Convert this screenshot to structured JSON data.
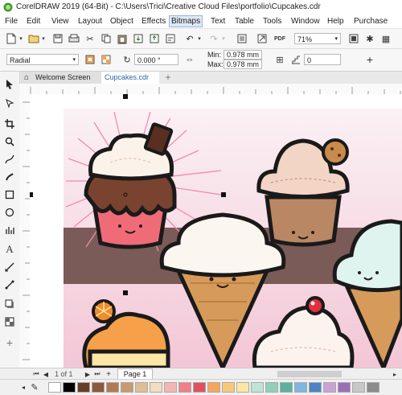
{
  "title": "CorelDRAW 2019 (64-Bit) - C:\\Users\\Trici\\Creative Cloud Files\\portfolio\\Cupcakes.cdr",
  "menu": [
    "File",
    "Edit",
    "View",
    "Layout",
    "Object",
    "Effects",
    "Bitmaps",
    "Text",
    "Table",
    "Tools",
    "Window",
    "Help",
    "Purchase"
  ],
  "menu_active": "Bitmaps",
  "toolbar": {
    "zoom": "71%"
  },
  "propbar": {
    "fill_type": "Radial",
    "angle": "0.000 °",
    "min_label": "Min:",
    "min_value": "0.978 mm",
    "max_label": "Max:",
    "max_value": "0.978 mm",
    "count": "0"
  },
  "tabs": {
    "welcome": "Welcome Screen",
    "doc": "Cupcakes.cdr",
    "add": "+"
  },
  "status": {
    "page_counter": "1 of 1",
    "page_tab": "Page 1"
  },
  "palette_colors": [
    "#ffffff",
    "#000000",
    "#6b3d24",
    "#8a5a3a",
    "#b07b52",
    "#c99a6e",
    "#e2bd93",
    "#f3dcc0",
    "#f6b5b5",
    "#f07f8a",
    "#e24f5f",
    "#f7a55c",
    "#f9c97a",
    "#fde7a3",
    "#bfe3d6",
    "#8fd0bb",
    "#5ab39a",
    "#7fb6e0",
    "#4a84c4",
    "#c9a3d6",
    "#9b6fb5",
    "#c8c8c8",
    "#8c8c8c"
  ],
  "colors": {
    "accent": "#3d7fc4",
    "pink_bg": "#f7dbe5",
    "band": "#7a5a55"
  }
}
